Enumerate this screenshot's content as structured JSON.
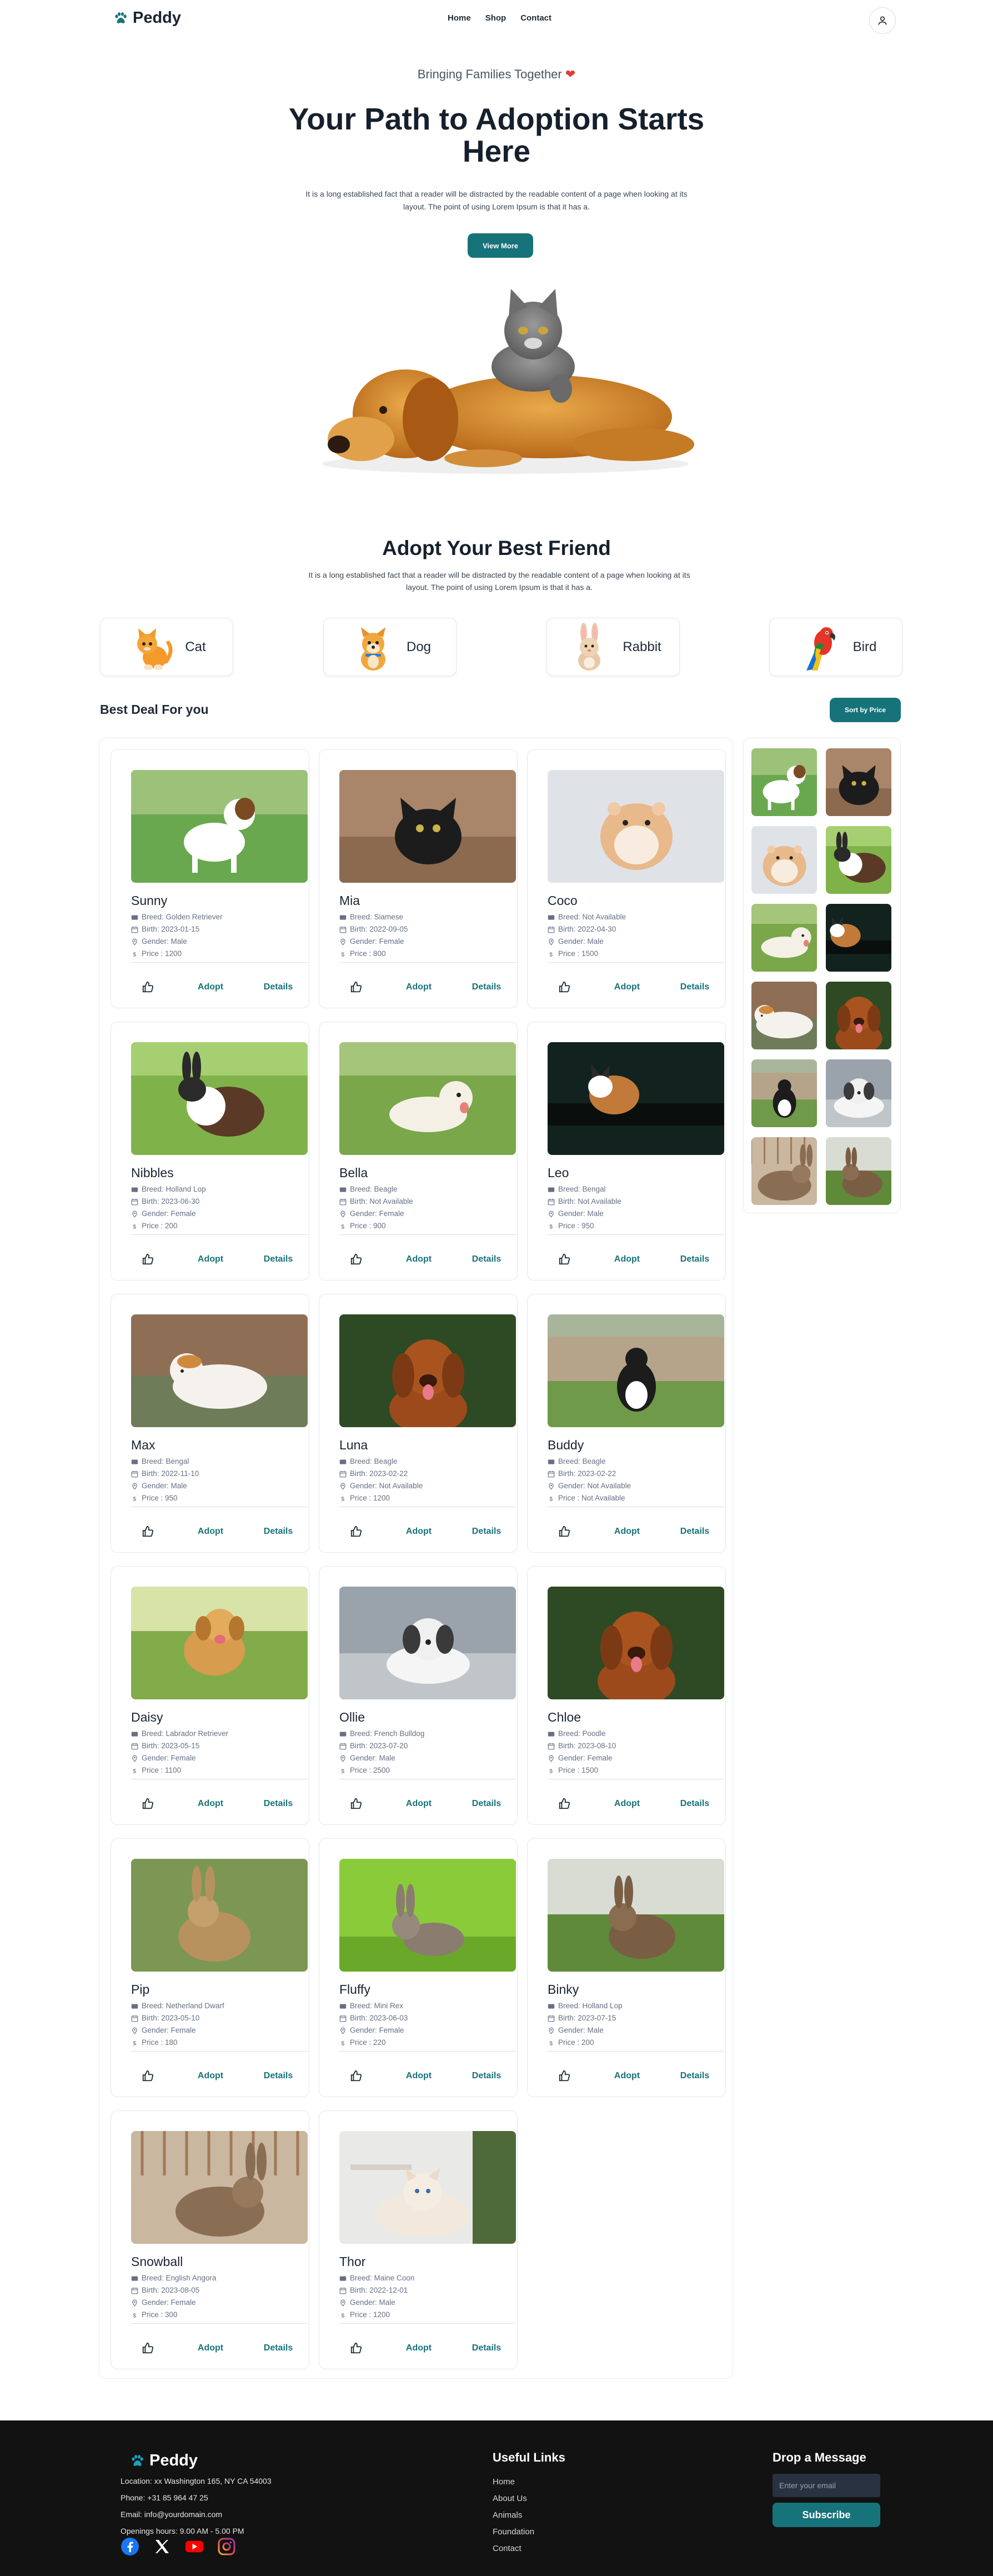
{
  "brand": {
    "name": "Peddy"
  },
  "nav": {
    "links": [
      "Home",
      "Shop",
      "Contact"
    ]
  },
  "hero": {
    "tagline": "Bringing Families Together",
    "title": "Your Path to Adoption Starts Here",
    "description": "It is a long established fact that a reader will be distracted by the readable content of a page when looking at its layout. The point of using Lorem Ipsum is that it has a.",
    "button": "View More"
  },
  "adopt": {
    "title": "Adopt Your Best Friend",
    "description": "It is a long established fact that a reader will be distracted by the readable content of a page when looking at its layout. The point of using Lorem Ipsum is that it has a.",
    "categories": [
      "Cat",
      "Dog",
      "Rabbit",
      "Bird"
    ]
  },
  "deals": {
    "title": "Best Deal For you",
    "sort_button": "Sort by Price"
  },
  "labels": {
    "breed": "Breed: ",
    "birth": "Birth: ",
    "gender": "Gender: ",
    "price": "Price : ",
    "adopt": "Adopt",
    "details": "Details"
  },
  "pets": [
    {
      "name": "Sunny",
      "breed": "Golden Retriever",
      "birth": "2023-01-15",
      "gender": "Male",
      "price": "1200",
      "photo": "dog-terrier"
    },
    {
      "name": "Mia",
      "breed": "Siamese",
      "birth": "2022-09-05",
      "gender": "Female",
      "price": "800",
      "photo": "cat-black"
    },
    {
      "name": "Coco",
      "breed": "Not Available",
      "birth": "2022-04-30",
      "gender": "Male",
      "price": "1500",
      "photo": "hamster"
    },
    {
      "name": "Nibbles",
      "breed": "Holland Lop",
      "birth": "2023-06-30",
      "gender": "Female",
      "price": "200",
      "photo": "rabbit-bw"
    },
    {
      "name": "Bella",
      "breed": "Beagle",
      "birth": "Not Available",
      "gender": "Female",
      "price": "900",
      "photo": "dog-white"
    },
    {
      "name": "Leo",
      "breed": "Bengal",
      "birth": "Not Available",
      "gender": "Male",
      "price": "950",
      "photo": "cat-dark"
    },
    {
      "name": "Max",
      "breed": "Bengal",
      "birth": "2022-11-10",
      "gender": "Male",
      "price": "950",
      "photo": "cat-white"
    },
    {
      "name": "Luna",
      "breed": "Beagle",
      "birth": "2023-02-22",
      "gender": "Not Available",
      "price": "1200",
      "photo": "dog-red"
    },
    {
      "name": "Buddy",
      "breed": "Beagle",
      "birth": "2023-02-22",
      "gender": "Not Available",
      "price": "Not Available",
      "photo": "dog-collie"
    },
    {
      "name": "Daisy",
      "breed": "Labrador Retriever",
      "birth": "2023-05-15",
      "gender": "Female",
      "price": "1100",
      "photo": "dog-running"
    },
    {
      "name": "Ollie",
      "breed": "French Bulldog",
      "birth": "2023-07-20",
      "gender": "Male",
      "price": "2500",
      "photo": "dog-shihtzu"
    },
    {
      "name": "Chloe",
      "breed": "Poodle",
      "birth": "2023-08-10",
      "gender": "Female",
      "price": "1500",
      "photo": "dog-red"
    },
    {
      "name": "Pip",
      "breed": "Netherland Dwarf",
      "birth": "2023-05-10",
      "gender": "Female",
      "price": "180",
      "photo": "rabbit-brown"
    },
    {
      "name": "Fluffy",
      "breed": "Mini Rex",
      "birth": "2023-06-03",
      "gender": "Female",
      "price": "220",
      "photo": "rabbit-grey"
    },
    {
      "name": "Binky",
      "breed": "Holland Lop",
      "birth": "2023-07-15",
      "gender": "Male",
      "price": "200",
      "photo": "rabbit-wild"
    },
    {
      "name": "Snowball",
      "breed": "English Angora",
      "birth": "2023-08-05",
      "gender": "Female",
      "price": "300",
      "photo": "rabbit-cage"
    },
    {
      "name": "Thor",
      "breed": "Maine Coon",
      "birth": "2022-12-01",
      "gender": "Male",
      "price": "1200",
      "photo": "cat-persian"
    }
  ],
  "gallery": [
    "dog-terrier",
    "cat-black",
    "hamster",
    "rabbit-bw",
    "dog-white",
    "cat-dark",
    "cat-white",
    "dog-red",
    "dog-collie",
    "dog-shihtzu",
    "rabbit-cage",
    "rabbit-wild"
  ],
  "footer": {
    "location": "Location: xx Washington 165, NY CA 54003",
    "phone": "Phone: +31 85 964 47 25",
    "email": "Email: info@yourdomain.com",
    "hours": "Openings hours: 9.00 AM - 5.00 PM",
    "useful_title": "Useful Links",
    "links": [
      "Home",
      "About Us",
      "Animals",
      "Foundation",
      "Contact"
    ],
    "drop_title": "Drop a Message",
    "email_placeholder": "Enter your email",
    "subscribe": "Subscribe"
  },
  "colors": {
    "accent": "#17737a",
    "footer_bg": "#121212",
    "heart": "#e53935"
  }
}
